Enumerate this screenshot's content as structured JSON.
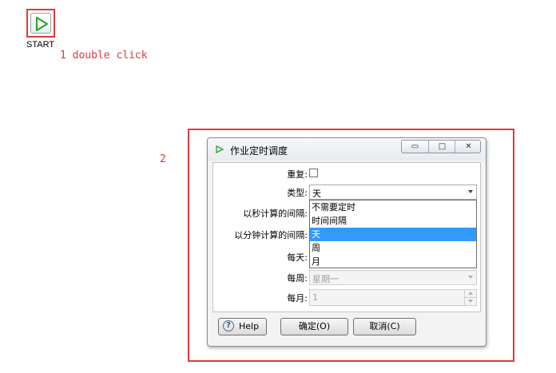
{
  "start": {
    "label": "START"
  },
  "annotations": {
    "step1": "1 double click",
    "step2": "2"
  },
  "dialog": {
    "title": "作业定时调度",
    "window_controls": {
      "minimize": "▭",
      "maximize": "□",
      "close": "✕"
    },
    "fields": {
      "repeat_label": "重复:",
      "type_label": "类型:",
      "type_value": "天",
      "seconds_label": "以秒计算的间隔:",
      "minutes_label": "以分钟计算的间隔:",
      "daily_label": "每天:",
      "weekly_label": "每周:",
      "weekly_value": "星期一",
      "monthly_label": "每月:",
      "monthly_value": "1"
    },
    "type_options": [
      "不需要定时",
      "时间间隔",
      "天",
      "周",
      "月"
    ],
    "type_selected_index": 2,
    "buttons": {
      "help": "Help",
      "ok": "确定(O)",
      "cancel": "取消(C)"
    }
  },
  "colors": {
    "highlight": "#e23a3a",
    "selection": "#3399ff",
    "play_icon": "#2ca02c"
  }
}
